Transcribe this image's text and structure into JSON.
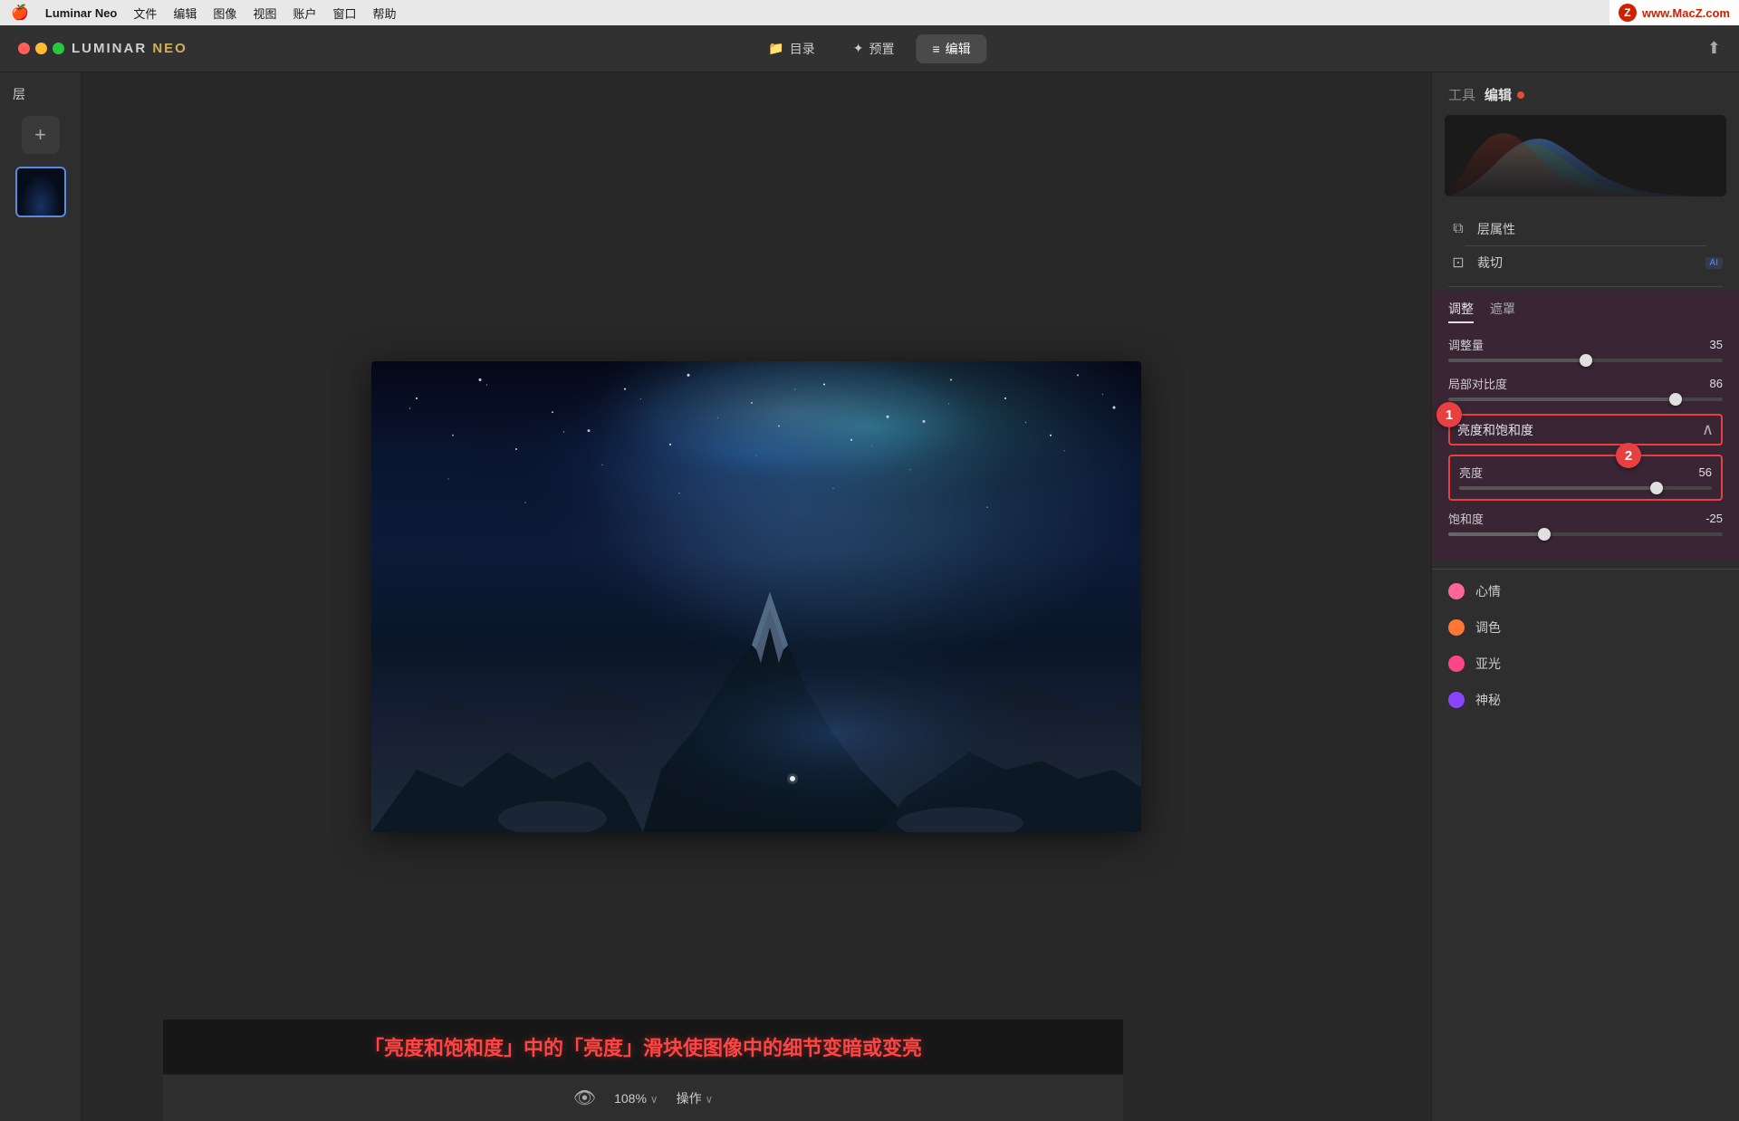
{
  "menubar": {
    "apple": "🍎",
    "appname": "Luminar Neo",
    "menus": [
      "文件",
      "编辑",
      "图像",
      "视图",
      "账户",
      "窗口",
      "帮助"
    ],
    "watermark": "www.MacZ.com"
  },
  "toolbar": {
    "logo": "LUMINAR NEO",
    "tabs": [
      {
        "label": "目录",
        "icon": "📁",
        "active": false
      },
      {
        "label": "预置",
        "icon": "✦",
        "active": false
      },
      {
        "label": "编辑",
        "icon": "≡",
        "active": true
      }
    ]
  },
  "layers": {
    "title": "层",
    "add_button": "+"
  },
  "right_panel": {
    "tools_label": "工具",
    "edit_label": "编辑",
    "sections": {
      "layer_props": "层属性",
      "crop": "裁切",
      "crop_ai": "AI"
    },
    "adjustments": {
      "tab1": "调整",
      "tab2": "遮罩",
      "sliders": [
        {
          "label": "调整量",
          "value": 35,
          "percent": 50
        },
        {
          "label": "局部对比度",
          "value": 86,
          "percent": 83
        }
      ]
    },
    "brightness_saturation": {
      "title": "亮度和饱和度",
      "brightness": {
        "label": "亮度",
        "value": 56,
        "percent": 78
      },
      "saturation": {
        "label": "饱和度",
        "value": -25,
        "percent": 35
      }
    },
    "tools": [
      {
        "label": "心情",
        "color": "#ff6699"
      },
      {
        "label": "调色",
        "color": "#ff7733"
      },
      {
        "label": "亚光",
        "color": "#ff4488"
      },
      {
        "label": "神秘",
        "color": "#8844ff"
      }
    ]
  },
  "statusbar": {
    "zoom": "108%",
    "ops": "操作"
  },
  "caption": {
    "text": "「亮度和饱和度」中的「亮度」滑块使图像中的细节变暗或变亮"
  },
  "annotations": {
    "badge1": "1",
    "badge2": "2"
  }
}
